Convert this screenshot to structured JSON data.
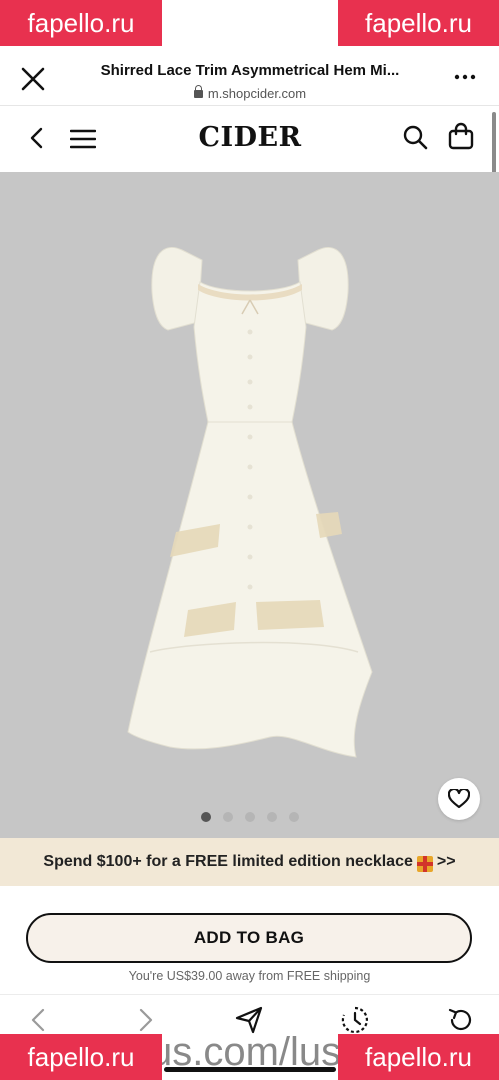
{
  "browser": {
    "title": "Shirred Lace Trim Asymmetrical Hem Mi...",
    "url": "m.shopcider.com"
  },
  "site": {
    "logo": "CIDER"
  },
  "gallery": {
    "slide_count": 5,
    "active_slide": 1
  },
  "promo": {
    "text_before": "Spend $100+ for a FREE limited edition necklace",
    "text_after": " >>"
  },
  "purchase": {
    "add_to_bag_label": "ADD TO BAG",
    "shipping_note": "You're US$39.00 away from FREE shipping"
  },
  "watermark": {
    "corner_text": "fapello.ru",
    "bottom_text": "us.com/lus"
  },
  "icons": [
    "close-icon",
    "lock-icon",
    "more-icon",
    "back-icon",
    "menu-icon",
    "search-icon",
    "bag-icon",
    "heart-icon",
    "gift-icon",
    "share-icon",
    "history-icon",
    "reload-icon"
  ],
  "colors": {
    "gallery_bg": "#c6c6c6",
    "promo_bg": "#f2e8d6",
    "button_bg": "#f7f1ea",
    "watermark": "#e8314f"
  }
}
